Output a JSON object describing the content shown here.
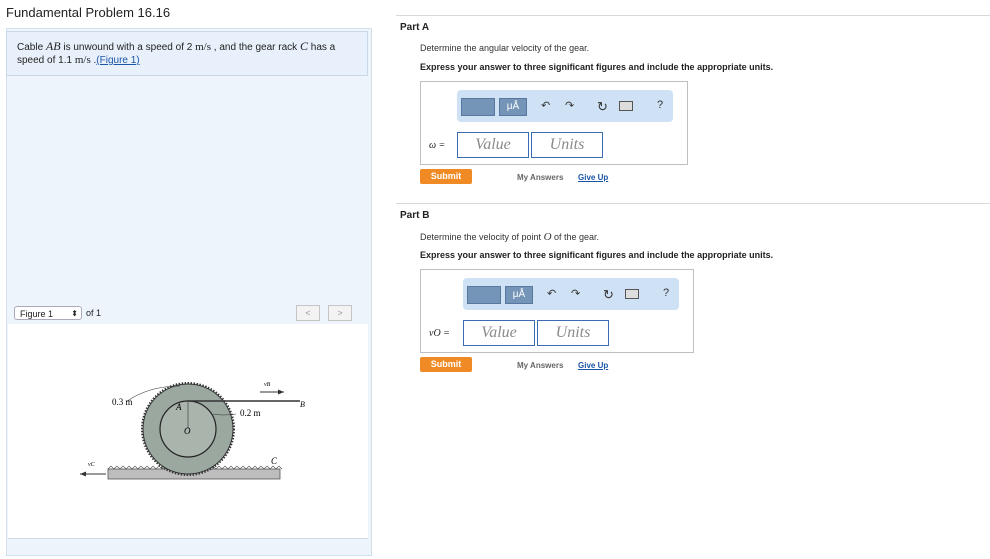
{
  "page_title": "Fundamental Problem 16.16",
  "problem": {
    "text_1": "Cable ",
    "var_ab": "AB",
    "text_2": " is unwound with a speed of 2 ",
    "unit_1": "m/s",
    "text_3": " , and the gear rack ",
    "var_c": "C",
    "text_4": " has a speed of 1.1 ",
    "unit_2": "m/s",
    "text_5": " .",
    "figure_link": "(Figure 1)"
  },
  "figure_nav": {
    "select_value": "Figure 1",
    "of_label": "of 1",
    "prev": "<",
    "next": ">"
  },
  "figure": {
    "label_outer": "0.3 m",
    "label_inner": "0.2 m",
    "label_a": "A",
    "label_o": "O",
    "label_b": "B",
    "label_c": "C",
    "label_vb": "vB",
    "label_vc": "vC"
  },
  "part_a": {
    "title": "Part A",
    "question": "Determine the angular velocity of the gear.",
    "instruction": "Express your answer to three significant figures and include the appropriate units.",
    "var_label": "ω =",
    "value_placeholder": "Value",
    "units_placeholder": "Units",
    "submit": "Submit",
    "my_answers": "My Answers",
    "give_up": "Give Up"
  },
  "part_b": {
    "title": "Part B",
    "question_1": "Determine the velocity of point ",
    "question_var": "O",
    "question_2": " of the gear.",
    "instruction": "Express your answer to three significant figures and include the appropriate units.",
    "var_label": "vO =",
    "value_placeholder": "Value",
    "units_placeholder": "Units",
    "submit": "Submit",
    "my_answers": "My Answers",
    "give_up": "Give Up"
  },
  "toolbar": {
    "mu_label": "μÅ",
    "help": "?",
    "undo": "↶",
    "redo": "↷",
    "reset": "↻"
  },
  "colors": {
    "submit_bg": "#f08a24",
    "link": "#1a55a6",
    "toolbar_bg": "#cfe2f5",
    "gear": "#9aa8a0"
  }
}
